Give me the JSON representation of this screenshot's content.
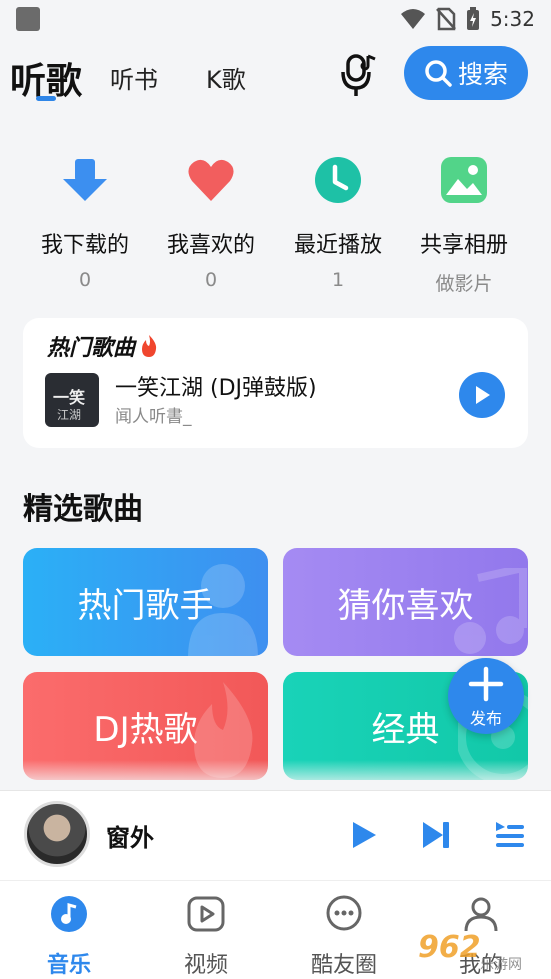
{
  "status_bar": {
    "time": "5:32"
  },
  "header": {
    "tabs": [
      {
        "label": "听歌",
        "active": true
      },
      {
        "label": "听书",
        "active": false
      },
      {
        "label": "K歌",
        "active": false
      }
    ],
    "search_label": "搜索",
    "accent_color": "#2e88ec"
  },
  "quick_entries": [
    {
      "label": "我下载的",
      "value": "0",
      "icon": "download-icon"
    },
    {
      "label": "我喜欢的",
      "value": "0",
      "icon": "heart-icon"
    },
    {
      "label": "最近播放",
      "value": "1",
      "icon": "clock-icon"
    },
    {
      "label": "共享相册",
      "value": "做影片",
      "icon": "album-icon"
    }
  ],
  "hot_songs": {
    "title": "热门歌曲",
    "song": {
      "title": "一笑江湖 (DJ弹鼓版)",
      "artist": "闻人听書_"
    }
  },
  "featured": {
    "title": "精选歌曲",
    "tiles": [
      {
        "label": "热门歌手"
      },
      {
        "label": "猜你喜欢"
      },
      {
        "label": "DJ热歌"
      },
      {
        "label": "经典"
      }
    ],
    "publish_label": "发布"
  },
  "player": {
    "title": "窗外"
  },
  "bottom_nav": [
    {
      "label": "音乐",
      "active": true
    },
    {
      "label": "视频",
      "active": false
    },
    {
      "label": "酷友圈",
      "active": false
    },
    {
      "label": "我的",
      "active": false
    }
  ],
  "watermark": {
    "text": "962",
    "sub": "乐游网"
  }
}
